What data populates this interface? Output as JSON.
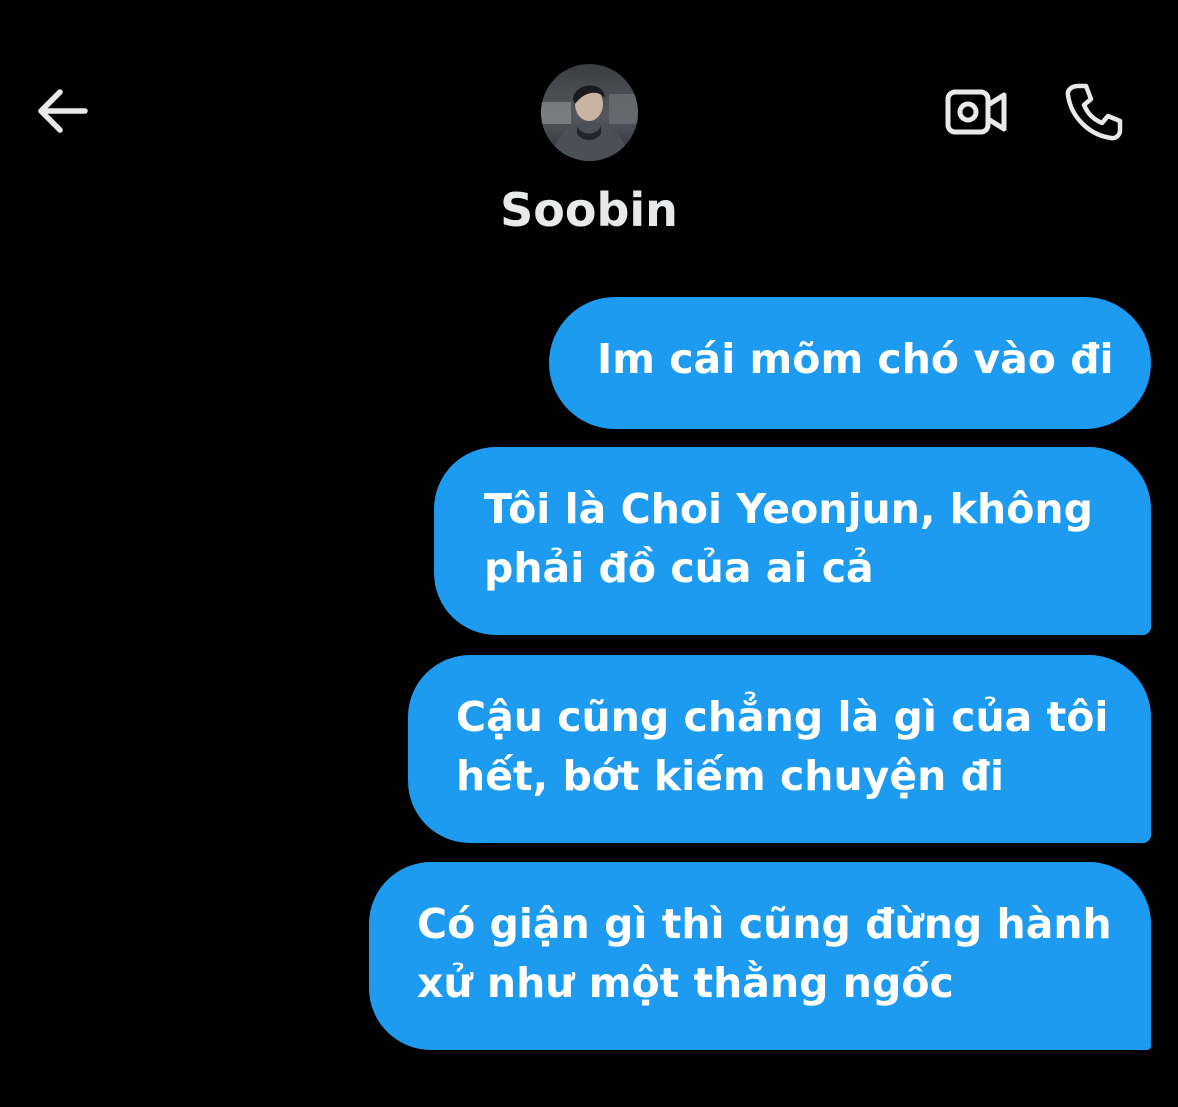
{
  "header": {
    "contact_name": "Soobin",
    "back_icon": "arrow-left-icon",
    "video_icon": "video-camera-icon",
    "call_icon": "phone-icon"
  },
  "messages": [
    {
      "sender": "me",
      "lines": [
        "Im cái mõm chó vào đi"
      ]
    },
    {
      "sender": "me",
      "lines": [
        "Tôi là Choi Yeonjun, không",
        "phải đồ của ai cả"
      ]
    },
    {
      "sender": "me",
      "lines": [
        "Cậu cũng chẳng là gì của tôi",
        "hết, bớt kiếm chuyện đi"
      ]
    },
    {
      "sender": "me",
      "lines": [
        "Có giận gì thì cũng đừng hành",
        "xử như một thằng ngốc"
      ]
    }
  ],
  "colors": {
    "background": "#000000",
    "bubble": "#1d9bf0",
    "icon": "#e7e9ea"
  }
}
